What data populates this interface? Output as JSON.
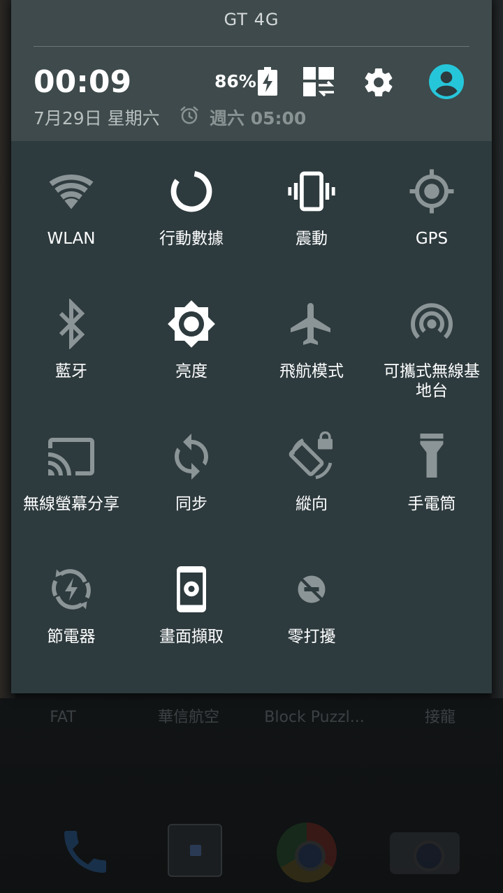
{
  "header": {
    "carrier": "GT 4G",
    "time": "00:09",
    "date": "7月29日 星期六",
    "alarm": "週六 05:00",
    "battery_percent": "86%",
    "battery_level": 0.86,
    "battery_charging": true,
    "accent_color": "#26c6da"
  },
  "tiles": [
    {
      "label": "WLAN",
      "icon": "wifi-icon",
      "active": false
    },
    {
      "label": "行動數據",
      "icon": "mobile-data-icon",
      "active": true
    },
    {
      "label": "震動",
      "icon": "vibrate-icon",
      "active": true
    },
    {
      "label": "GPS",
      "icon": "gps-icon",
      "active": false
    },
    {
      "label": "藍牙",
      "icon": "bluetooth-icon",
      "active": false
    },
    {
      "label": "亮度",
      "icon": "brightness-icon",
      "active": true
    },
    {
      "label": "飛航模式",
      "icon": "airplane-icon",
      "active": false
    },
    {
      "label": "可攜式無線基地台",
      "icon": "hotspot-icon",
      "active": false
    },
    {
      "label": "無線螢幕分享",
      "icon": "cast-icon",
      "active": false
    },
    {
      "label": "同步",
      "icon": "sync-icon",
      "active": false
    },
    {
      "label": "縱向",
      "icon": "rotation-lock-icon",
      "active": false
    },
    {
      "label": "手電筒",
      "icon": "flashlight-icon",
      "active": false
    },
    {
      "label": "節電器",
      "icon": "battery-saver-icon",
      "active": false
    },
    {
      "label": "畫面擷取",
      "icon": "screenshot-icon",
      "active": true
    },
    {
      "label": "零打擾",
      "icon": "do-not-disturb-icon",
      "active": false
    }
  ],
  "home": {
    "labels": [
      "FAT",
      "華信航空",
      "Block Puzzl...",
      "接龍"
    ]
  }
}
